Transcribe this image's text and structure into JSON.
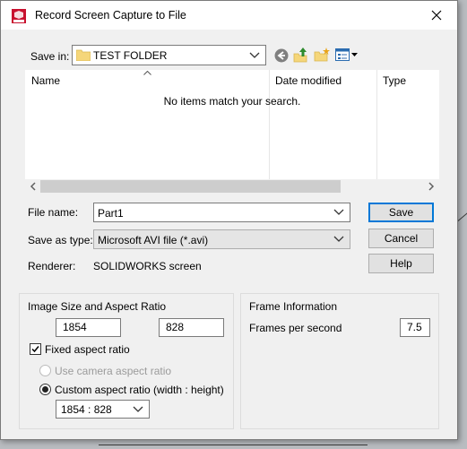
{
  "window": {
    "title": "Record Screen Capture to File",
    "close_icon": "close-icon"
  },
  "save_in": {
    "label": "Save in:",
    "value": "TEST FOLDER"
  },
  "toolbar": {
    "icons": [
      "back-icon",
      "up-folder-icon",
      "new-folder-icon",
      "view-menu-icon"
    ]
  },
  "file_list": {
    "columns": [
      "Name",
      "Date modified",
      "Type"
    ],
    "empty_message": "No items match your search."
  },
  "file_name": {
    "label": "File name:",
    "value": "Part1"
  },
  "save_as_type": {
    "label": "Save as type:",
    "value": "Microsoft AVI file (*.avi)"
  },
  "renderer": {
    "label": "Renderer:",
    "value": "SOLIDWORKS screen"
  },
  "buttons": {
    "save": "Save",
    "cancel": "Cancel",
    "help": "Help"
  },
  "image_size": {
    "title": "Image Size and Aspect Ratio",
    "width": "1854",
    "height": "828",
    "fixed_aspect_label": "Fixed aspect ratio",
    "fixed_aspect_checked": true,
    "camera_aspect_label": "Use camera aspect ratio",
    "custom_aspect_label": "Custom aspect ratio (width : height)",
    "custom_aspect_value": "1854 : 828"
  },
  "frame_info": {
    "title": "Frame Information",
    "fps_label": "Frames per second",
    "fps_value": "7.5"
  },
  "colors": {
    "accent": "#0078d7",
    "folder": "#f5d67a"
  }
}
